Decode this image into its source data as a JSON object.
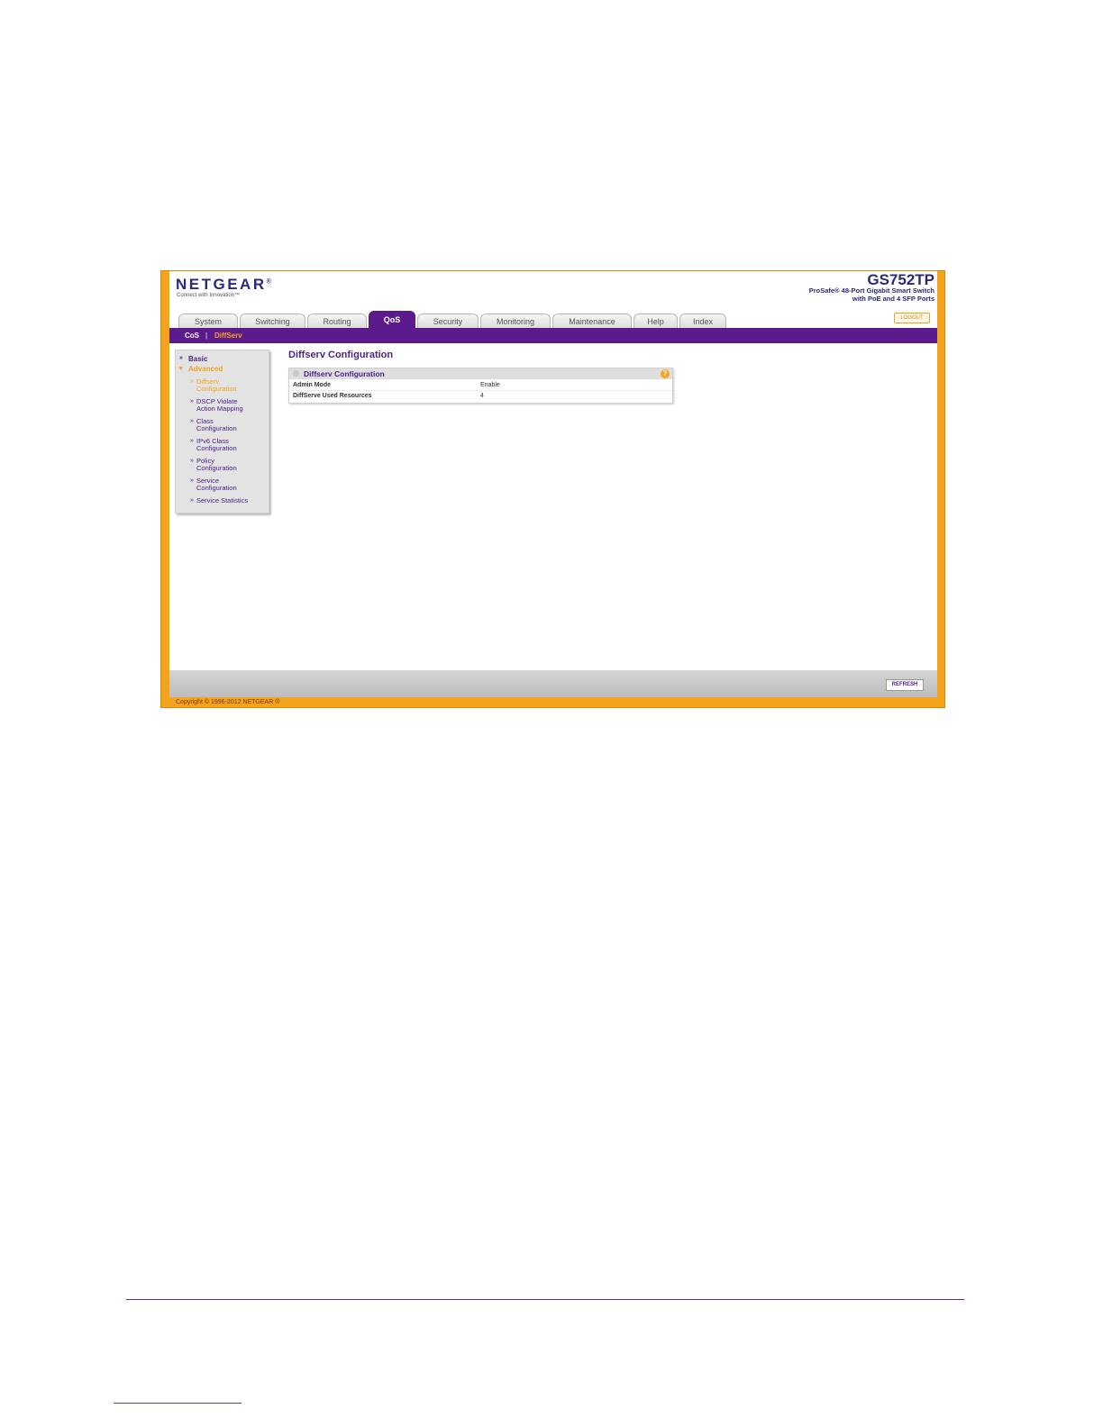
{
  "header": {
    "logo": "NETGEAR",
    "logo_mark": "®",
    "tagline": "Connect with Innovation™",
    "model": "GS752TP",
    "product_line1": "ProSafe® 48-Port Gigabit Smart Switch",
    "product_line2": "with PoE and 4 SFP Ports",
    "logout": "LOGOUT"
  },
  "tabs": [
    {
      "label": "System"
    },
    {
      "label": "Switching"
    },
    {
      "label": "Routing"
    },
    {
      "label": "QoS",
      "active": true
    },
    {
      "label": "Security"
    },
    {
      "label": "Monitoring"
    },
    {
      "label": "Maintenance"
    },
    {
      "label": "Help"
    },
    {
      "label": "Index"
    }
  ],
  "subnav": {
    "item1": "CoS",
    "separator": "|",
    "item2": "DiffServ"
  },
  "sidebar": {
    "basic": "Basic",
    "advanced": "Advanced",
    "items": [
      {
        "line1": "Diffserv",
        "line2": "Configuration"
      },
      {
        "line1": "DSCP Violate",
        "line2": "Action Mapping"
      },
      {
        "line1": "Class",
        "line2": "Configuration"
      },
      {
        "line1": "IPv6 Class",
        "line2": "Configuration"
      },
      {
        "line1": "Policy",
        "line2": "Configuration"
      },
      {
        "line1": "Service",
        "line2": "Configuration"
      },
      {
        "line1": "Service Statistics",
        "line2": ""
      }
    ]
  },
  "main": {
    "title": "Diffserv Configuration",
    "panel_title": "Diffserv Configuration",
    "rows": [
      {
        "label": "Admin Mode",
        "value": "Enable"
      },
      {
        "label": "DiffServe Used Resources",
        "value": "4"
      }
    ]
  },
  "footer": {
    "refresh": "REFRESH",
    "copyright": "Copyright © 1996-2012 NETGEAR ®"
  },
  "colors": {
    "brand_purple": "#5b1b8c",
    "accent_orange": "#f4a31c"
  },
  "icons": {
    "help": "help-icon",
    "collapse": "collapse-icon"
  }
}
